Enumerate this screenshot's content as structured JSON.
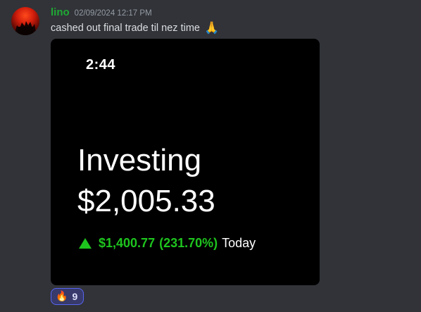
{
  "message": {
    "author": "lino",
    "timestamp": "02/09/2024 12:17 PM",
    "text": "cashed out final trade til nez time",
    "emoji": "🙏"
  },
  "attachment": {
    "phone_time": "2:44",
    "label": "Investing",
    "value": "$2,005.33",
    "change_amount": "$1,400.77",
    "change_percent": "(231.70%)",
    "change_period": "Today",
    "change_color": "#1ec41e"
  },
  "reaction": {
    "emoji": "🔥",
    "count": "9"
  },
  "colors": {
    "background": "#313338",
    "username": "#1fa934",
    "reaction_border": "#5865f2"
  },
  "icons": {
    "avatar": "avatar-image",
    "arrow": "up-arrow-icon"
  }
}
